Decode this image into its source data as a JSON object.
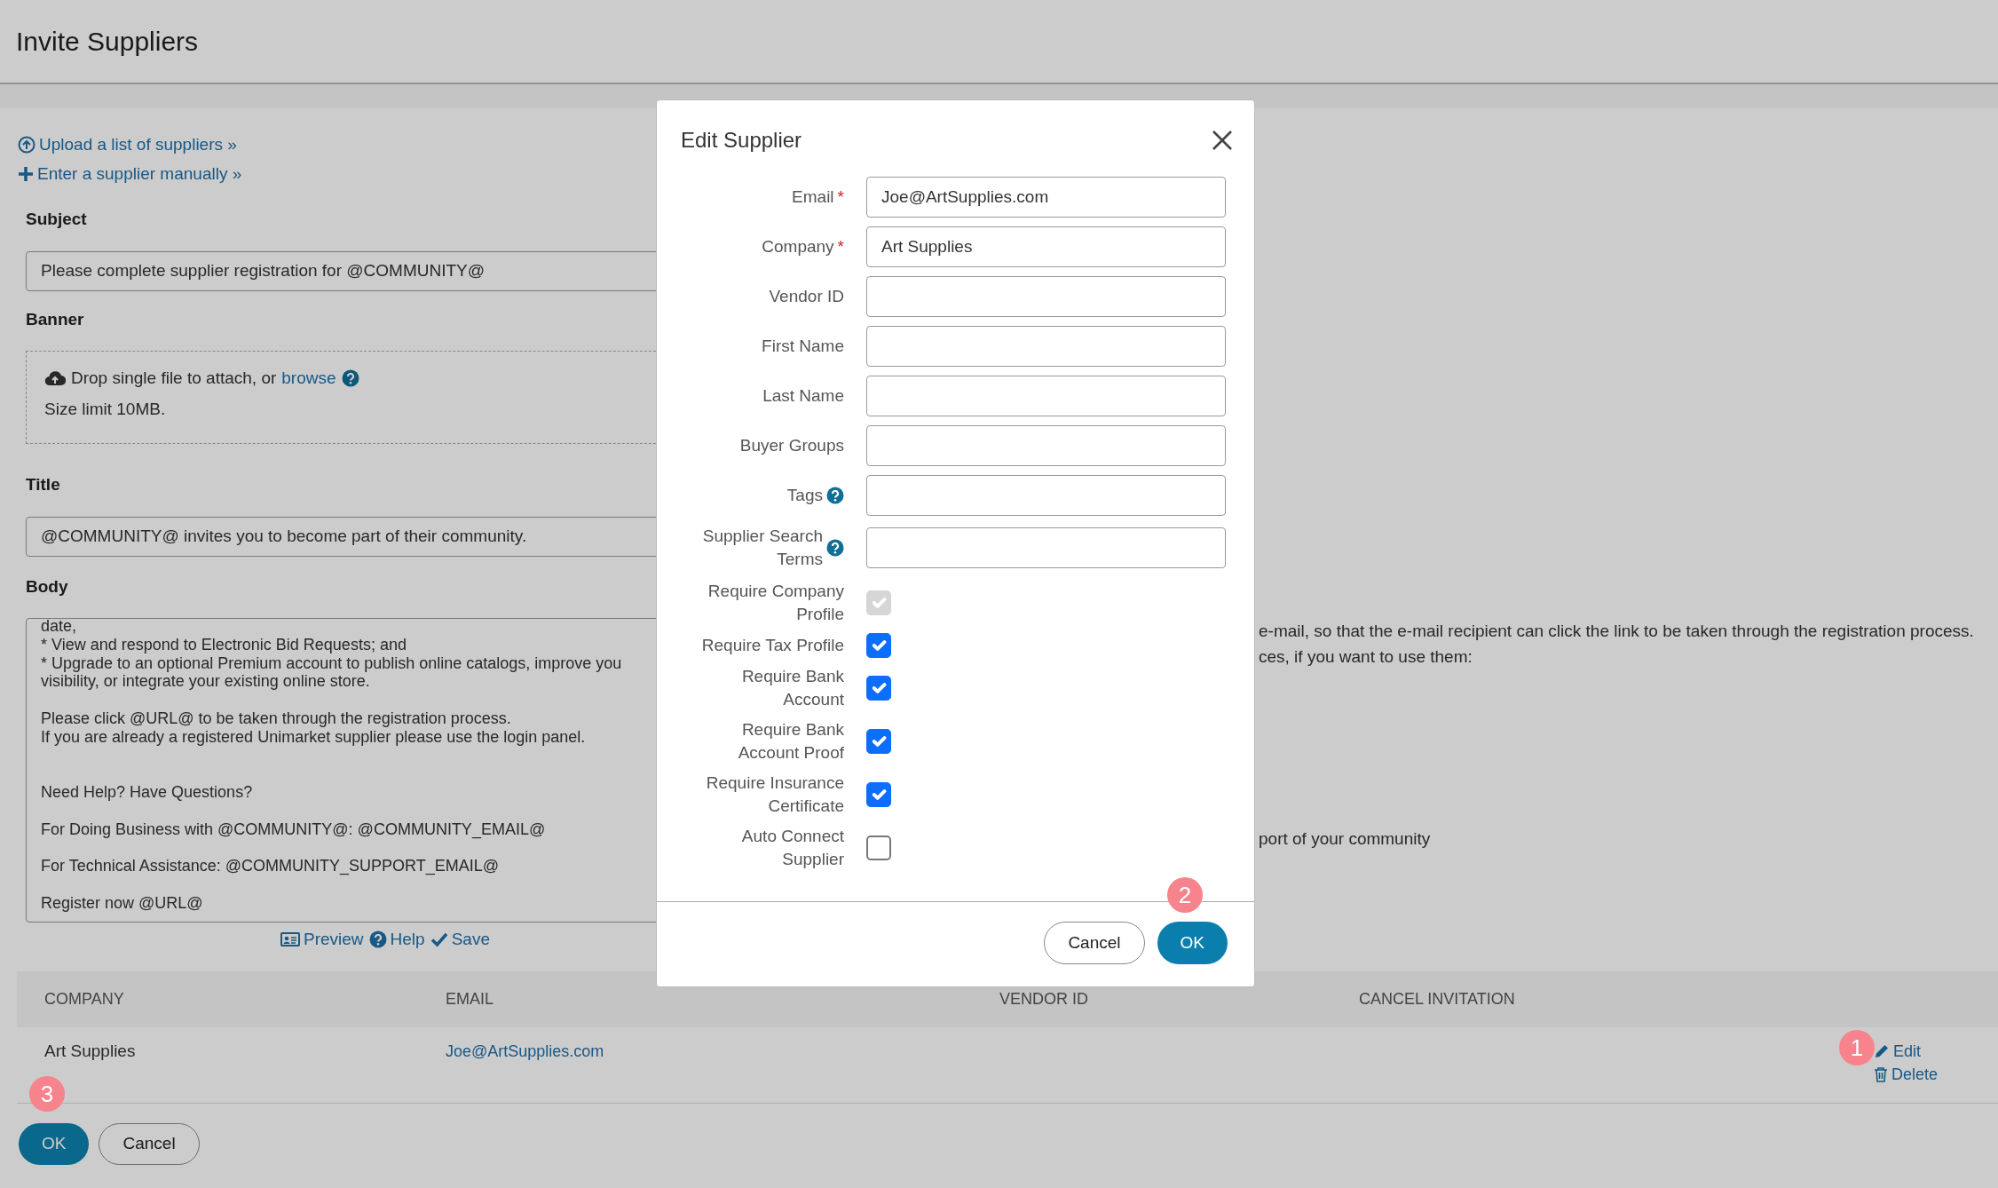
{
  "page": {
    "title": "Invite Suppliers"
  },
  "actions": [
    {
      "kind": "upload",
      "label": "Upload a list of suppliers »"
    },
    {
      "kind": "add",
      "label": "Enter a supplier manually »"
    }
  ],
  "form": {
    "subject": {
      "label": "Subject",
      "value": "Please complete supplier registration for @COMMUNITY@"
    },
    "banner": {
      "label": "Banner",
      "drop_text": "Drop single file to attach, or",
      "browse_link": "browse",
      "size_limit": "Size limit 10MB."
    },
    "title": {
      "label": "Title",
      "value": "@COMMUNITY@ invites you to become part of their community."
    },
    "body": {
      "label": "Body",
      "value": "date,\n* View and respond to Electronic Bid Requests; and\n* Upgrade to an optional Premium account to publish online catalogs, improve you\nvisibility, or integrate your existing online store.\n\nPlease click @URL@ to be taken through the registration process.\nIf you are already a registered Unimarket supplier please use the login panel.\n\n\nNeed Help? Have Questions?\n\nFor Doing Business with @COMMUNITY@: @COMMUNITY_EMAIL@\n\nFor Technical Assistance: @COMMUNITY_SUPPORT_EMAIL@\n\nRegister now @URL@"
    },
    "tools": [
      {
        "kind": "preview",
        "label": "Preview"
      },
      {
        "kind": "help",
        "label": "Help"
      },
      {
        "kind": "save",
        "label": "Save"
      }
    ]
  },
  "help_text": [
    {
      "text": "e-mail, so that the e-mail recipient can click the link to be taken through the registration process."
    },
    {
      "text": "ces, if you want to use them:"
    },
    {
      "text": "port of your community"
    }
  ],
  "table": {
    "columns": [
      "COMPANY",
      "EMAIL",
      "VENDOR ID",
      "CANCEL INVITATION"
    ],
    "rows": [
      {
        "company": "Art Supplies",
        "email": "Joe@ArtSupplies.com",
        "marker": "1",
        "actions": [
          {
            "kind": "edit",
            "label": "Edit"
          },
          {
            "kind": "delete",
            "label": "Delete"
          }
        ]
      }
    ]
  },
  "buttons": [
    {
      "kind": "primary",
      "label": "OK",
      "marker": "3"
    },
    {
      "kind": "secondary",
      "label": "Cancel"
    }
  ],
  "modal": {
    "title": "Edit Supplier",
    "fields": [
      {
        "label": "Email",
        "value": "Joe@ArtSupplies.com",
        "required_mark": "*",
        "help": false
      },
      {
        "label": "Company",
        "value": "Art Supplies",
        "required_mark": "*",
        "help": false
      },
      {
        "label": "Vendor ID",
        "help": false
      },
      {
        "label": "First Name",
        "help": false
      },
      {
        "label": "Last Name",
        "help": false
      },
      {
        "label": "Buyer Groups",
        "help": false
      },
      {
        "label": "Tags",
        "help": true
      },
      {
        "label": "Supplier Search Terms",
        "help": true
      }
    ],
    "checkboxes": [
      {
        "label": "Require Company Profile",
        "checked": true,
        "disabled": true
      },
      {
        "label": "Require Tax Profile",
        "checked": true,
        "disabled": false
      },
      {
        "label": "Require Bank Account",
        "checked": true,
        "disabled": false
      },
      {
        "label": "Require Bank Account Proof",
        "checked": true,
        "disabled": false
      },
      {
        "label": "Require Insurance Certificate",
        "checked": true,
        "disabled": false
      },
      {
        "label": "Auto Connect Supplier",
        "checked": false,
        "disabled": false
      }
    ],
    "buttons": [
      {
        "kind": "secondary",
        "label": "Cancel"
      },
      {
        "kind": "primary",
        "label": "OK",
        "marker": "2"
      }
    ]
  }
}
